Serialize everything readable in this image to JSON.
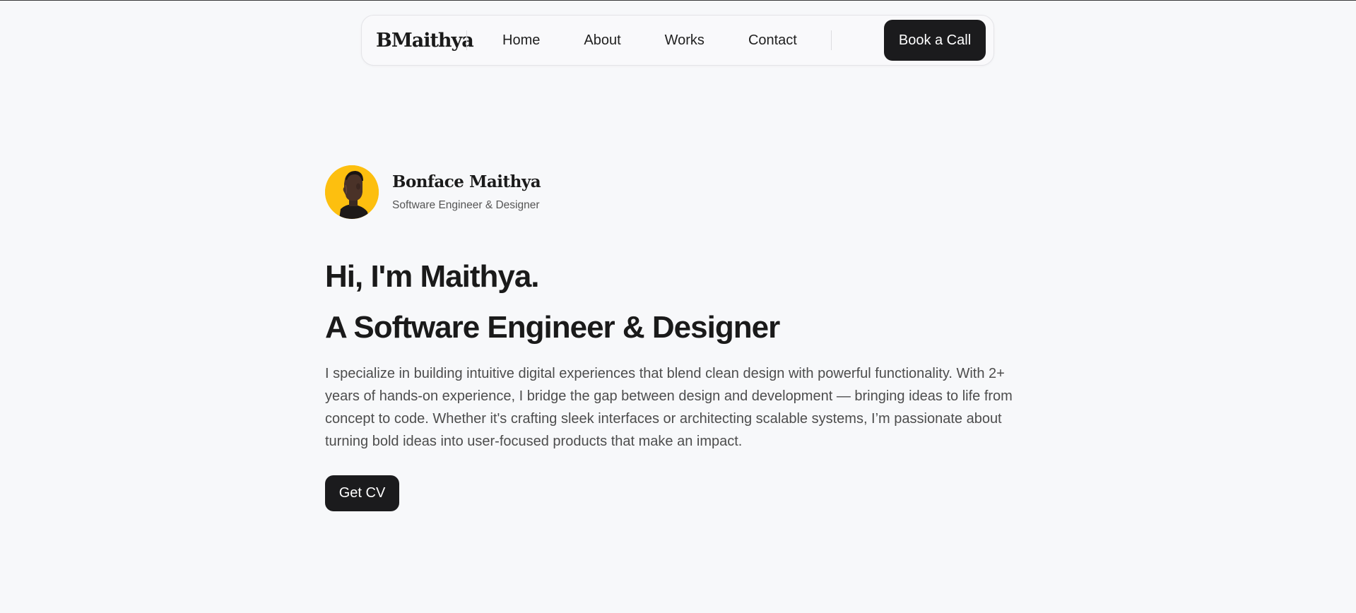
{
  "nav": {
    "logo": "BMaithya",
    "links": [
      "Home",
      "About",
      "Works",
      "Contact"
    ],
    "cta_label": "Book a Call"
  },
  "profile": {
    "name": "Bonface Maithya",
    "role": "Software Engineer & Designer",
    "avatar_bg_color": "#fdbf0f"
  },
  "hero": {
    "headline_line1": "Hi, I'm Maithya.",
    "headline_line2": "A Software Engineer & Designer",
    "bio": "I specialize in building intuitive digital experiences that blend clean design with powerful functionality. With 2+ years of hands-on experience, I bridge the gap between design and development — bringing ideas to life from concept to code. Whether it's crafting sleek interfaces or architecting scalable systems, I’m passionate about turning bold ideas into user-focused products that make an impact.",
    "cv_label": "Get CV"
  },
  "colors": {
    "background": "#f7f8fa",
    "button_dark": "#1b1b1d",
    "accent_yellow": "#fdbf0f"
  }
}
